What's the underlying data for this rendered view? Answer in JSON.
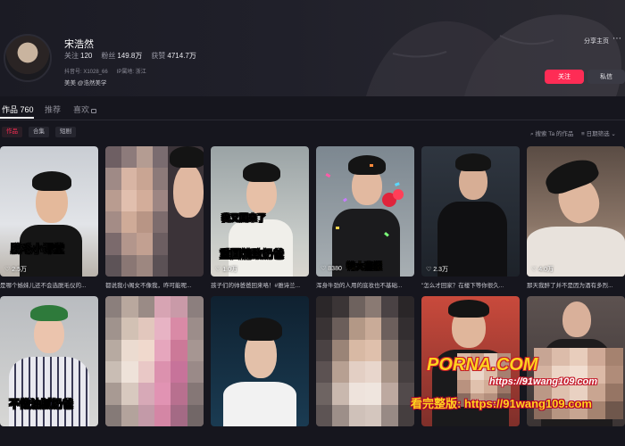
{
  "profile": {
    "nickname": "宋浩然",
    "stats": [
      {
        "label": "关注",
        "value": "120"
      },
      {
        "label": "粉丝",
        "value": "149.8万"
      },
      {
        "label": "获赞",
        "value": "4714.7万"
      }
    ],
    "douyin_id": "抖音号: X1028_66",
    "ip_location": "IP属地: 浙江",
    "bio": "美美 @浩然美学",
    "share_label": "分享主页",
    "more_icon": "more-horizontal-icon",
    "follow_label": "关注",
    "message_label": "私信"
  },
  "tabs": {
    "works_label": "作品",
    "works_count": "760",
    "recommend_label": "推荐",
    "likes_label": "喜欢",
    "lock_icon": "lock-icon"
  },
  "filters": {
    "chips": [
      "作品",
      "合集",
      "短剧"
    ],
    "search_label": "搜索 Ta 的作品",
    "sort_label": "日期筛选"
  },
  "videos": [
    {
      "likes": "2.5万",
      "caption": "是哪个姊妹儿还不会选脱毛仪的...",
      "overlay": "脱毛小课堂"
    },
    {
      "likes": "",
      "caption": "都说我小阁女不像我，昨可能呢...",
      "overlay": ""
    },
    {
      "likes": "1.0万",
      "caption": "孩子们的帅爸爸回来咯！#雅诗兰...",
      "overlay": "重回精致奶爸",
      "overlay2": "我又回来了"
    },
    {
      "likes": "8380",
      "caption": "浑身牛劲的人用的底妆也不基础...",
      "overlay": "特大喜报"
    },
    {
      "likes": "2.3万",
      "caption": "\"怎么才回家？在楼下等你很久...",
      "overlay": ""
    },
    {
      "likes": "4.0万",
      "caption": "那天我醉了并不是因为酒有多烈...",
      "overlay": ""
    },
    {
      "likes": "",
      "caption": "",
      "overlay": "不做油腻奶爸"
    },
    {
      "likes": "",
      "caption": "",
      "overlay": ""
    },
    {
      "likes": "",
      "caption": "",
      "overlay": ""
    },
    {
      "likes": "",
      "caption": "",
      "overlay": ""
    },
    {
      "likes": "",
      "caption": "",
      "overlay": ""
    },
    {
      "likes": "",
      "caption": "",
      "overlay": ""
    }
  ],
  "watermark": {
    "logo": "PORNA.COM",
    "url": "https://91wang109.com",
    "notice": "看完整版: https://91wang109.com"
  },
  "colors": {
    "accent": "#fe2c55",
    "background": "#16161e",
    "watermark": "#ffd21f"
  }
}
